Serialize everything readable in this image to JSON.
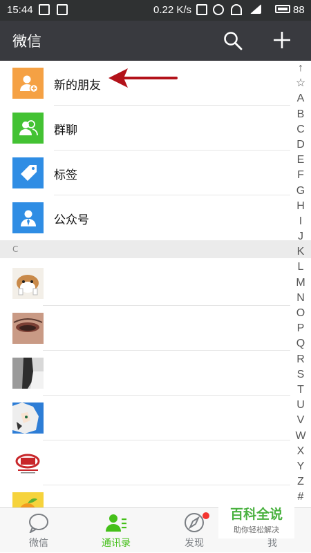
{
  "status_bar": {
    "time": "15:44",
    "speed": "0.22 K/s",
    "battery": "88"
  },
  "app_bar": {
    "title": "微信"
  },
  "menu": [
    {
      "label": "新的朋友",
      "icon": "new-friend-icon",
      "color": "#f5a144"
    },
    {
      "label": "群聊",
      "icon": "group-chat-icon",
      "color": "#43c233"
    },
    {
      "label": "标签",
      "icon": "tag-icon",
      "color": "#2f8de4"
    },
    {
      "label": "公众号",
      "icon": "official-account-icon",
      "color": "#2f8de4"
    }
  ],
  "section_header": "C",
  "contacts": [
    {
      "avatar": "hamster-avatar"
    },
    {
      "avatar": "eye-makeup-avatar"
    },
    {
      "avatar": "photo-avatar"
    },
    {
      "avatar": "anime-avatar"
    },
    {
      "avatar": "logo-avatar"
    },
    {
      "avatar": "fruit-avatar"
    }
  ],
  "index_letters": [
    "↑",
    "☆",
    "A",
    "B",
    "C",
    "D",
    "E",
    "F",
    "G",
    "H",
    "I",
    "J",
    "K",
    "L",
    "M",
    "N",
    "O",
    "P",
    "Q",
    "R",
    "S",
    "T",
    "U",
    "V",
    "W",
    "X",
    "Y",
    "Z",
    "#"
  ],
  "tabs": [
    {
      "label": "微信",
      "active": false
    },
    {
      "label": "通讯录",
      "active": true
    },
    {
      "label": "发现",
      "active": false
    },
    {
      "label": "我",
      "active": false
    }
  ],
  "watermark": {
    "title": "百科全说",
    "subtitle": "助你轻松解决"
  },
  "colors": {
    "accent_green": "#45c01a",
    "header_bg": "#393a3f",
    "badge_red": "#f43530"
  }
}
